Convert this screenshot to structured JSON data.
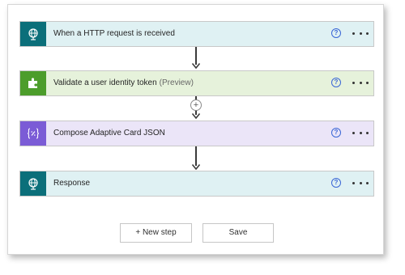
{
  "steps": [
    {
      "title": "When a HTTP request is received",
      "subtitle": "",
      "icon": "globe-request-icon",
      "color": "#0b6f7a",
      "bg": "#dff1f3"
    },
    {
      "title": "Validate a user identity token",
      "subtitle": "(Preview)",
      "icon": "puzzle-piece-icon",
      "color": "#4c9d2b",
      "bg": "#e6f2db"
    },
    {
      "title": "Compose Adaptive Card JSON",
      "subtitle": "",
      "icon": "curly-braces-icon",
      "color": "#7b5cd6",
      "bg": "#ebe5f8"
    },
    {
      "title": "Response",
      "subtitle": "",
      "icon": "globe-response-icon",
      "color": "#0b6f7a",
      "bg": "#dff1f3"
    }
  ],
  "help_glyph": "?",
  "insert_glyph": "+",
  "buttons": {
    "new_step": "+ New step",
    "save": "Save"
  }
}
